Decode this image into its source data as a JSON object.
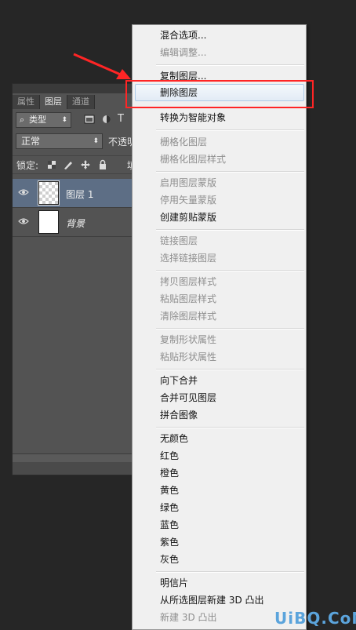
{
  "colors": {
    "accent_red": "#ff2525",
    "menu_bg": "#f0f0f0",
    "panel_bg": "#535353",
    "selected_layer": "#5d6e85",
    "watermark": "#5ba4dc"
  },
  "panel": {
    "tabs": [
      {
        "label": "属性"
      },
      {
        "label": "图层"
      },
      {
        "label": "通道"
      }
    ],
    "active_tab": "图层",
    "filter_label": "类型",
    "blend_mode": "正常",
    "opacity_label": "不透明",
    "lock_label": "锁定:",
    "fill_label": "填",
    "layers": [
      {
        "name": "图层 1",
        "selected": true,
        "thumbnail": "transparent"
      },
      {
        "name": "背景",
        "selected": false,
        "thumbnail": "white"
      }
    ]
  },
  "context_menu": {
    "items": [
      {
        "label": "混合选项...",
        "enabled": true
      },
      {
        "label": "编辑调整...",
        "enabled": false
      },
      {
        "label": "复制图层...",
        "enabled": true
      },
      {
        "label": "删除图层",
        "enabled": true,
        "highlighted": true
      },
      {
        "label": "转换为智能对象",
        "enabled": true
      },
      {
        "label": "栅格化图层",
        "enabled": false
      },
      {
        "label": "栅格化图层样式",
        "enabled": false
      },
      {
        "label": "启用图层蒙版",
        "enabled": false
      },
      {
        "label": "停用矢量蒙版",
        "enabled": false
      },
      {
        "label": "创建剪贴蒙版",
        "enabled": true
      },
      {
        "label": "链接图层",
        "enabled": false
      },
      {
        "label": "选择链接图层",
        "enabled": false
      },
      {
        "label": "拷贝图层样式",
        "enabled": false
      },
      {
        "label": "粘贴图层样式",
        "enabled": false
      },
      {
        "label": "清除图层样式",
        "enabled": false
      },
      {
        "label": "复制形状属性",
        "enabled": false
      },
      {
        "label": "粘贴形状属性",
        "enabled": false
      },
      {
        "label": "向下合并",
        "enabled": true
      },
      {
        "label": "合并可见图层",
        "enabled": true
      },
      {
        "label": "拼合图像",
        "enabled": true
      },
      {
        "label": "无颜色",
        "enabled": true
      },
      {
        "label": "红色",
        "enabled": true
      },
      {
        "label": "橙色",
        "enabled": true
      },
      {
        "label": "黄色",
        "enabled": true
      },
      {
        "label": "绿色",
        "enabled": true
      },
      {
        "label": "蓝色",
        "enabled": true
      },
      {
        "label": "紫色",
        "enabled": true
      },
      {
        "label": "灰色",
        "enabled": true
      },
      {
        "label": "明信片",
        "enabled": true
      },
      {
        "label": "从所选图层新建 3D 凸出",
        "enabled": true
      },
      {
        "label": "新建 3D 凸出",
        "enabled": false
      }
    ]
  },
  "watermark": "UiBQ.CoM"
}
